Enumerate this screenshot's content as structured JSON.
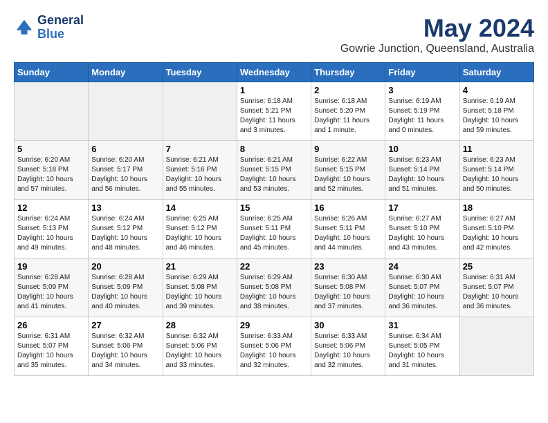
{
  "header": {
    "logo_line1": "General",
    "logo_line2": "Blue",
    "title": "May 2024",
    "subtitle": "Gowrie Junction, Queensland, Australia"
  },
  "days_of_week": [
    "Sunday",
    "Monday",
    "Tuesday",
    "Wednesday",
    "Thursday",
    "Friday",
    "Saturday"
  ],
  "weeks": [
    [
      {
        "day": "",
        "info": ""
      },
      {
        "day": "",
        "info": ""
      },
      {
        "day": "",
        "info": ""
      },
      {
        "day": "1",
        "info": "Sunrise: 6:18 AM\nSunset: 5:21 PM\nDaylight: 11 hours\nand 3 minutes."
      },
      {
        "day": "2",
        "info": "Sunrise: 6:18 AM\nSunset: 5:20 PM\nDaylight: 11 hours\nand 1 minute."
      },
      {
        "day": "3",
        "info": "Sunrise: 6:19 AM\nSunset: 5:19 PM\nDaylight: 11 hours\nand 0 minutes."
      },
      {
        "day": "4",
        "info": "Sunrise: 6:19 AM\nSunset: 5:18 PM\nDaylight: 10 hours\nand 59 minutes."
      }
    ],
    [
      {
        "day": "5",
        "info": "Sunrise: 6:20 AM\nSunset: 5:18 PM\nDaylight: 10 hours\nand 57 minutes."
      },
      {
        "day": "6",
        "info": "Sunrise: 6:20 AM\nSunset: 5:17 PM\nDaylight: 10 hours\nand 56 minutes."
      },
      {
        "day": "7",
        "info": "Sunrise: 6:21 AM\nSunset: 5:16 PM\nDaylight: 10 hours\nand 55 minutes."
      },
      {
        "day": "8",
        "info": "Sunrise: 6:21 AM\nSunset: 5:15 PM\nDaylight: 10 hours\nand 53 minutes."
      },
      {
        "day": "9",
        "info": "Sunrise: 6:22 AM\nSunset: 5:15 PM\nDaylight: 10 hours\nand 52 minutes."
      },
      {
        "day": "10",
        "info": "Sunrise: 6:23 AM\nSunset: 5:14 PM\nDaylight: 10 hours\nand 51 minutes."
      },
      {
        "day": "11",
        "info": "Sunrise: 6:23 AM\nSunset: 5:14 PM\nDaylight: 10 hours\nand 50 minutes."
      }
    ],
    [
      {
        "day": "12",
        "info": "Sunrise: 6:24 AM\nSunset: 5:13 PM\nDaylight: 10 hours\nand 49 minutes."
      },
      {
        "day": "13",
        "info": "Sunrise: 6:24 AM\nSunset: 5:12 PM\nDaylight: 10 hours\nand 48 minutes."
      },
      {
        "day": "14",
        "info": "Sunrise: 6:25 AM\nSunset: 5:12 PM\nDaylight: 10 hours\nand 46 minutes."
      },
      {
        "day": "15",
        "info": "Sunrise: 6:25 AM\nSunset: 5:11 PM\nDaylight: 10 hours\nand 45 minutes."
      },
      {
        "day": "16",
        "info": "Sunrise: 6:26 AM\nSunset: 5:11 PM\nDaylight: 10 hours\nand 44 minutes."
      },
      {
        "day": "17",
        "info": "Sunrise: 6:27 AM\nSunset: 5:10 PM\nDaylight: 10 hours\nand 43 minutes."
      },
      {
        "day": "18",
        "info": "Sunrise: 6:27 AM\nSunset: 5:10 PM\nDaylight: 10 hours\nand 42 minutes."
      }
    ],
    [
      {
        "day": "19",
        "info": "Sunrise: 6:28 AM\nSunset: 5:09 PM\nDaylight: 10 hours\nand 41 minutes."
      },
      {
        "day": "20",
        "info": "Sunrise: 6:28 AM\nSunset: 5:09 PM\nDaylight: 10 hours\nand 40 minutes."
      },
      {
        "day": "21",
        "info": "Sunrise: 6:29 AM\nSunset: 5:08 PM\nDaylight: 10 hours\nand 39 minutes."
      },
      {
        "day": "22",
        "info": "Sunrise: 6:29 AM\nSunset: 5:08 PM\nDaylight: 10 hours\nand 38 minutes."
      },
      {
        "day": "23",
        "info": "Sunrise: 6:30 AM\nSunset: 5:08 PM\nDaylight: 10 hours\nand 37 minutes."
      },
      {
        "day": "24",
        "info": "Sunrise: 6:30 AM\nSunset: 5:07 PM\nDaylight: 10 hours\nand 36 minutes."
      },
      {
        "day": "25",
        "info": "Sunrise: 6:31 AM\nSunset: 5:07 PM\nDaylight: 10 hours\nand 36 minutes."
      }
    ],
    [
      {
        "day": "26",
        "info": "Sunrise: 6:31 AM\nSunset: 5:07 PM\nDaylight: 10 hours\nand 35 minutes."
      },
      {
        "day": "27",
        "info": "Sunrise: 6:32 AM\nSunset: 5:06 PM\nDaylight: 10 hours\nand 34 minutes."
      },
      {
        "day": "28",
        "info": "Sunrise: 6:32 AM\nSunset: 5:06 PM\nDaylight: 10 hours\nand 33 minutes."
      },
      {
        "day": "29",
        "info": "Sunrise: 6:33 AM\nSunset: 5:06 PM\nDaylight: 10 hours\nand 32 minutes."
      },
      {
        "day": "30",
        "info": "Sunrise: 6:33 AM\nSunset: 5:06 PM\nDaylight: 10 hours\nand 32 minutes."
      },
      {
        "day": "31",
        "info": "Sunrise: 6:34 AM\nSunset: 5:05 PM\nDaylight: 10 hours\nand 31 minutes."
      },
      {
        "day": "",
        "info": ""
      }
    ]
  ]
}
